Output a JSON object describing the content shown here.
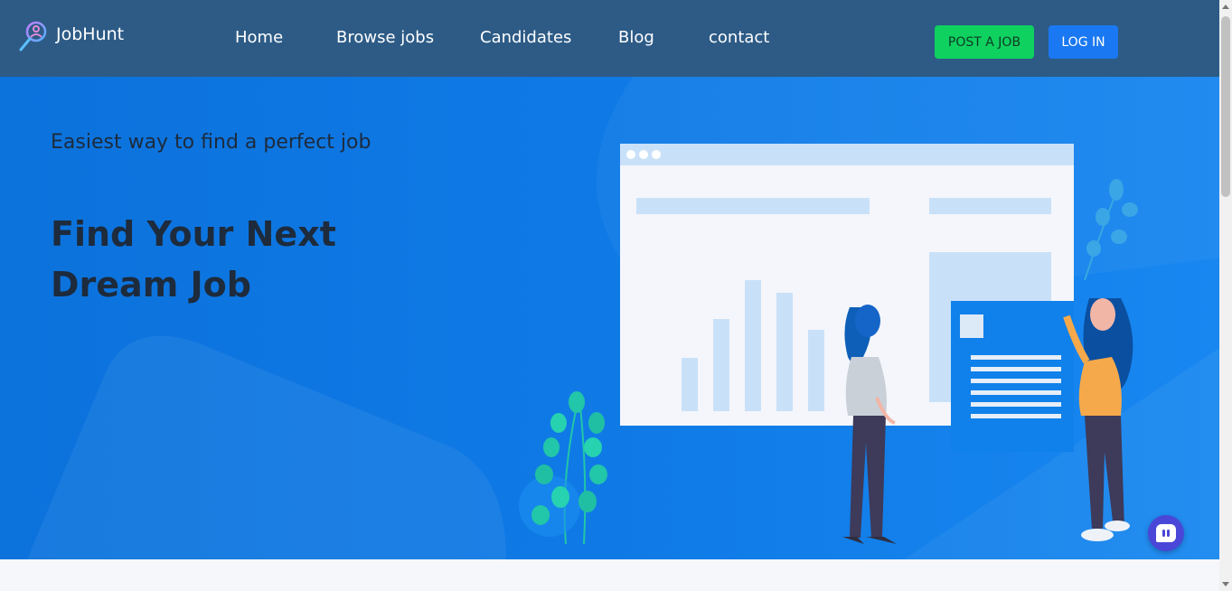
{
  "brand": {
    "name": "JobHunt",
    "icon": "magnifier-person-icon"
  },
  "nav": {
    "items": [
      {
        "label": "Home"
      },
      {
        "label": "Browse jobs"
      },
      {
        "label": "Candidates"
      },
      {
        "label": "Blog"
      },
      {
        "label": "contact"
      }
    ]
  },
  "header": {
    "post_job_label": "POST A JOB",
    "login_label": "LOG IN"
  },
  "hero": {
    "tagline": "Easiest way to find a perfect job",
    "headline": "Find Your Next Dream Job"
  },
  "colors": {
    "header_bg": "#2d5b86",
    "hero_bg": "#0f7ae6",
    "post_button": "#0fd15f",
    "login_button": "#1a78f2",
    "text_dark": "#1d2b3c"
  },
  "widgets": {
    "chat": "chat-bubble-icon"
  }
}
